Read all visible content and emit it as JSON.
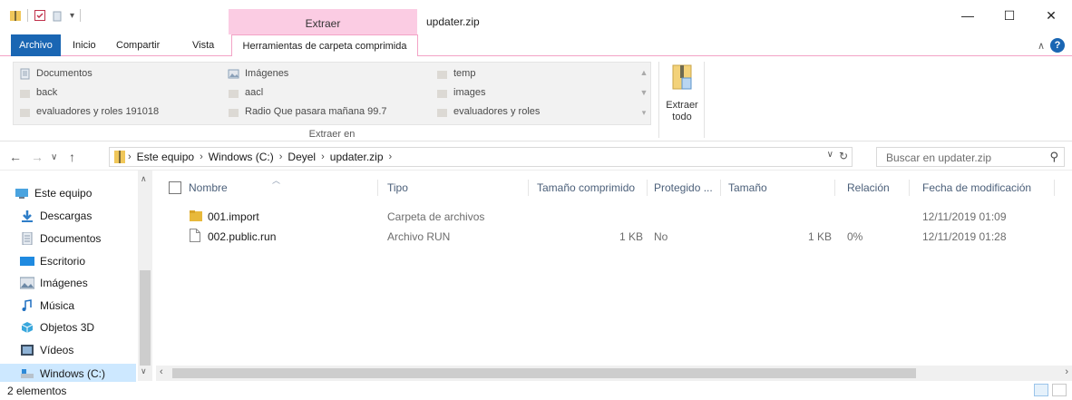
{
  "window": {
    "title": "updater.zip",
    "context_tab": "Extraer",
    "controls": {
      "minimize": "—",
      "maximize": "☐",
      "close": "✕"
    }
  },
  "ribbon": {
    "tabs": [
      "Archivo",
      "Inicio",
      "Compartir",
      "Vista",
      "Herramientas de carpeta comprimida"
    ],
    "gallery_items": [
      [
        "Documentos",
        "Imágenes",
        "temp"
      ],
      [
        "back",
        "aacl",
        "images"
      ],
      [
        "evaluadores y roles 191018",
        "Radio Que pasara mañana 99.7",
        "evaluadores y roles"
      ]
    ],
    "group_label": "Extraer en",
    "extract_all_label": "Extraer\ntodo"
  },
  "address": {
    "crumbs": [
      "Este equipo",
      "Windows (C:)",
      "Deyel",
      "updater.zip"
    ],
    "search_placeholder": "Buscar en updater.zip"
  },
  "nav_pane": {
    "items": [
      "Este equipo",
      "Descargas",
      "Documentos",
      "Escritorio",
      "Imágenes",
      "Música",
      "Objetos 3D",
      "Vídeos",
      "Windows (C:)"
    ],
    "selected": "Windows (C:)"
  },
  "file_list": {
    "columns": [
      "Nombre",
      "Tipo",
      "Tamaño comprimido",
      "Protegido ...",
      "Tamaño",
      "Relación",
      "Fecha de modificación"
    ],
    "rows": [
      {
        "name": "001.import",
        "type": "Carpeta de archivos",
        "compressed": "",
        "protected": "",
        "size": "",
        "ratio": "",
        "modified": "12/11/2019 01:09",
        "icon": "folder-icon"
      },
      {
        "name": "002.public.run",
        "type": "Archivo RUN",
        "compressed": "1 KB",
        "protected": "No",
        "size": "1 KB",
        "ratio": "0%",
        "modified": "12/11/2019 01:28",
        "icon": "file-icon"
      }
    ]
  },
  "status": {
    "count": "2 elementos"
  },
  "colors": {
    "accent": "#1a66b3",
    "context_pink": "#fbcce3",
    "selection": "#cde8ff",
    "header_text": "#4c607a"
  }
}
